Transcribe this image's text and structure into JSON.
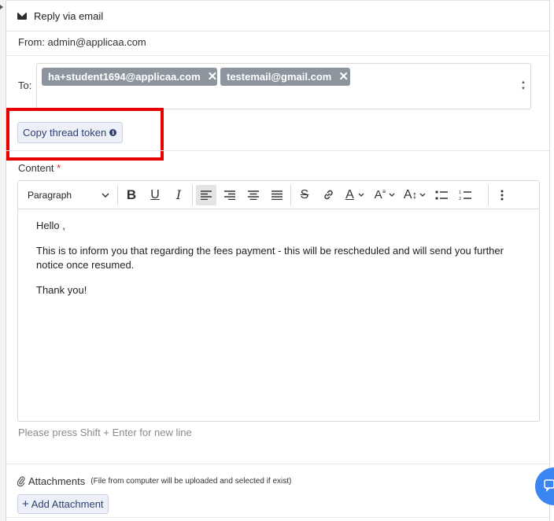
{
  "reply": {
    "header": "Reply via email",
    "from": "From: admin@applicaa.com",
    "to_label": "To:",
    "recipients": [
      "ha+student1694@applicaa.com",
      "testemail@gmail.com"
    ],
    "remove_glyph": "✕",
    "copy_token": "Copy thread token",
    "info_glyph": "i"
  },
  "content": {
    "label": "Content",
    "required_mark": "*",
    "paragraph_style": "Paragraph",
    "body": [
      "Hello ,",
      "This is to inform you that regarding the fees payment - this will be rescheduled and will send you further notice once resumed.",
      "Thank you!"
    ],
    "hint": "Please press Shift + Enter for new line"
  },
  "toolbar": {
    "bold": "B",
    "underline": "U",
    "italic": "I",
    "strike": "S",
    "font_color": "A",
    "font_size": "A",
    "icons": [
      "bold-icon",
      "underline-icon",
      "italic-icon",
      "align-left-icon",
      "align-right-icon",
      "align-center-icon",
      "align-justify-icon",
      "strikethrough-icon",
      "link-icon",
      "font-color-icon",
      "font-family-icon",
      "line-height-icon",
      "bullet-list-icon",
      "numbered-list-icon",
      "more-options-icon"
    ]
  },
  "attachments": {
    "label": "Attachments",
    "note": "(File from computer will be uploaded and selected if exist)",
    "add_button": "Add Attachment",
    "plus": "+"
  },
  "colors": {
    "chip_bg": "#8c959e",
    "button_bg": "#edf0f8",
    "button_text": "#2f3f6e",
    "highlight": "#e60000",
    "chat_bubble": "#3b86f2",
    "required": "#e02020"
  }
}
